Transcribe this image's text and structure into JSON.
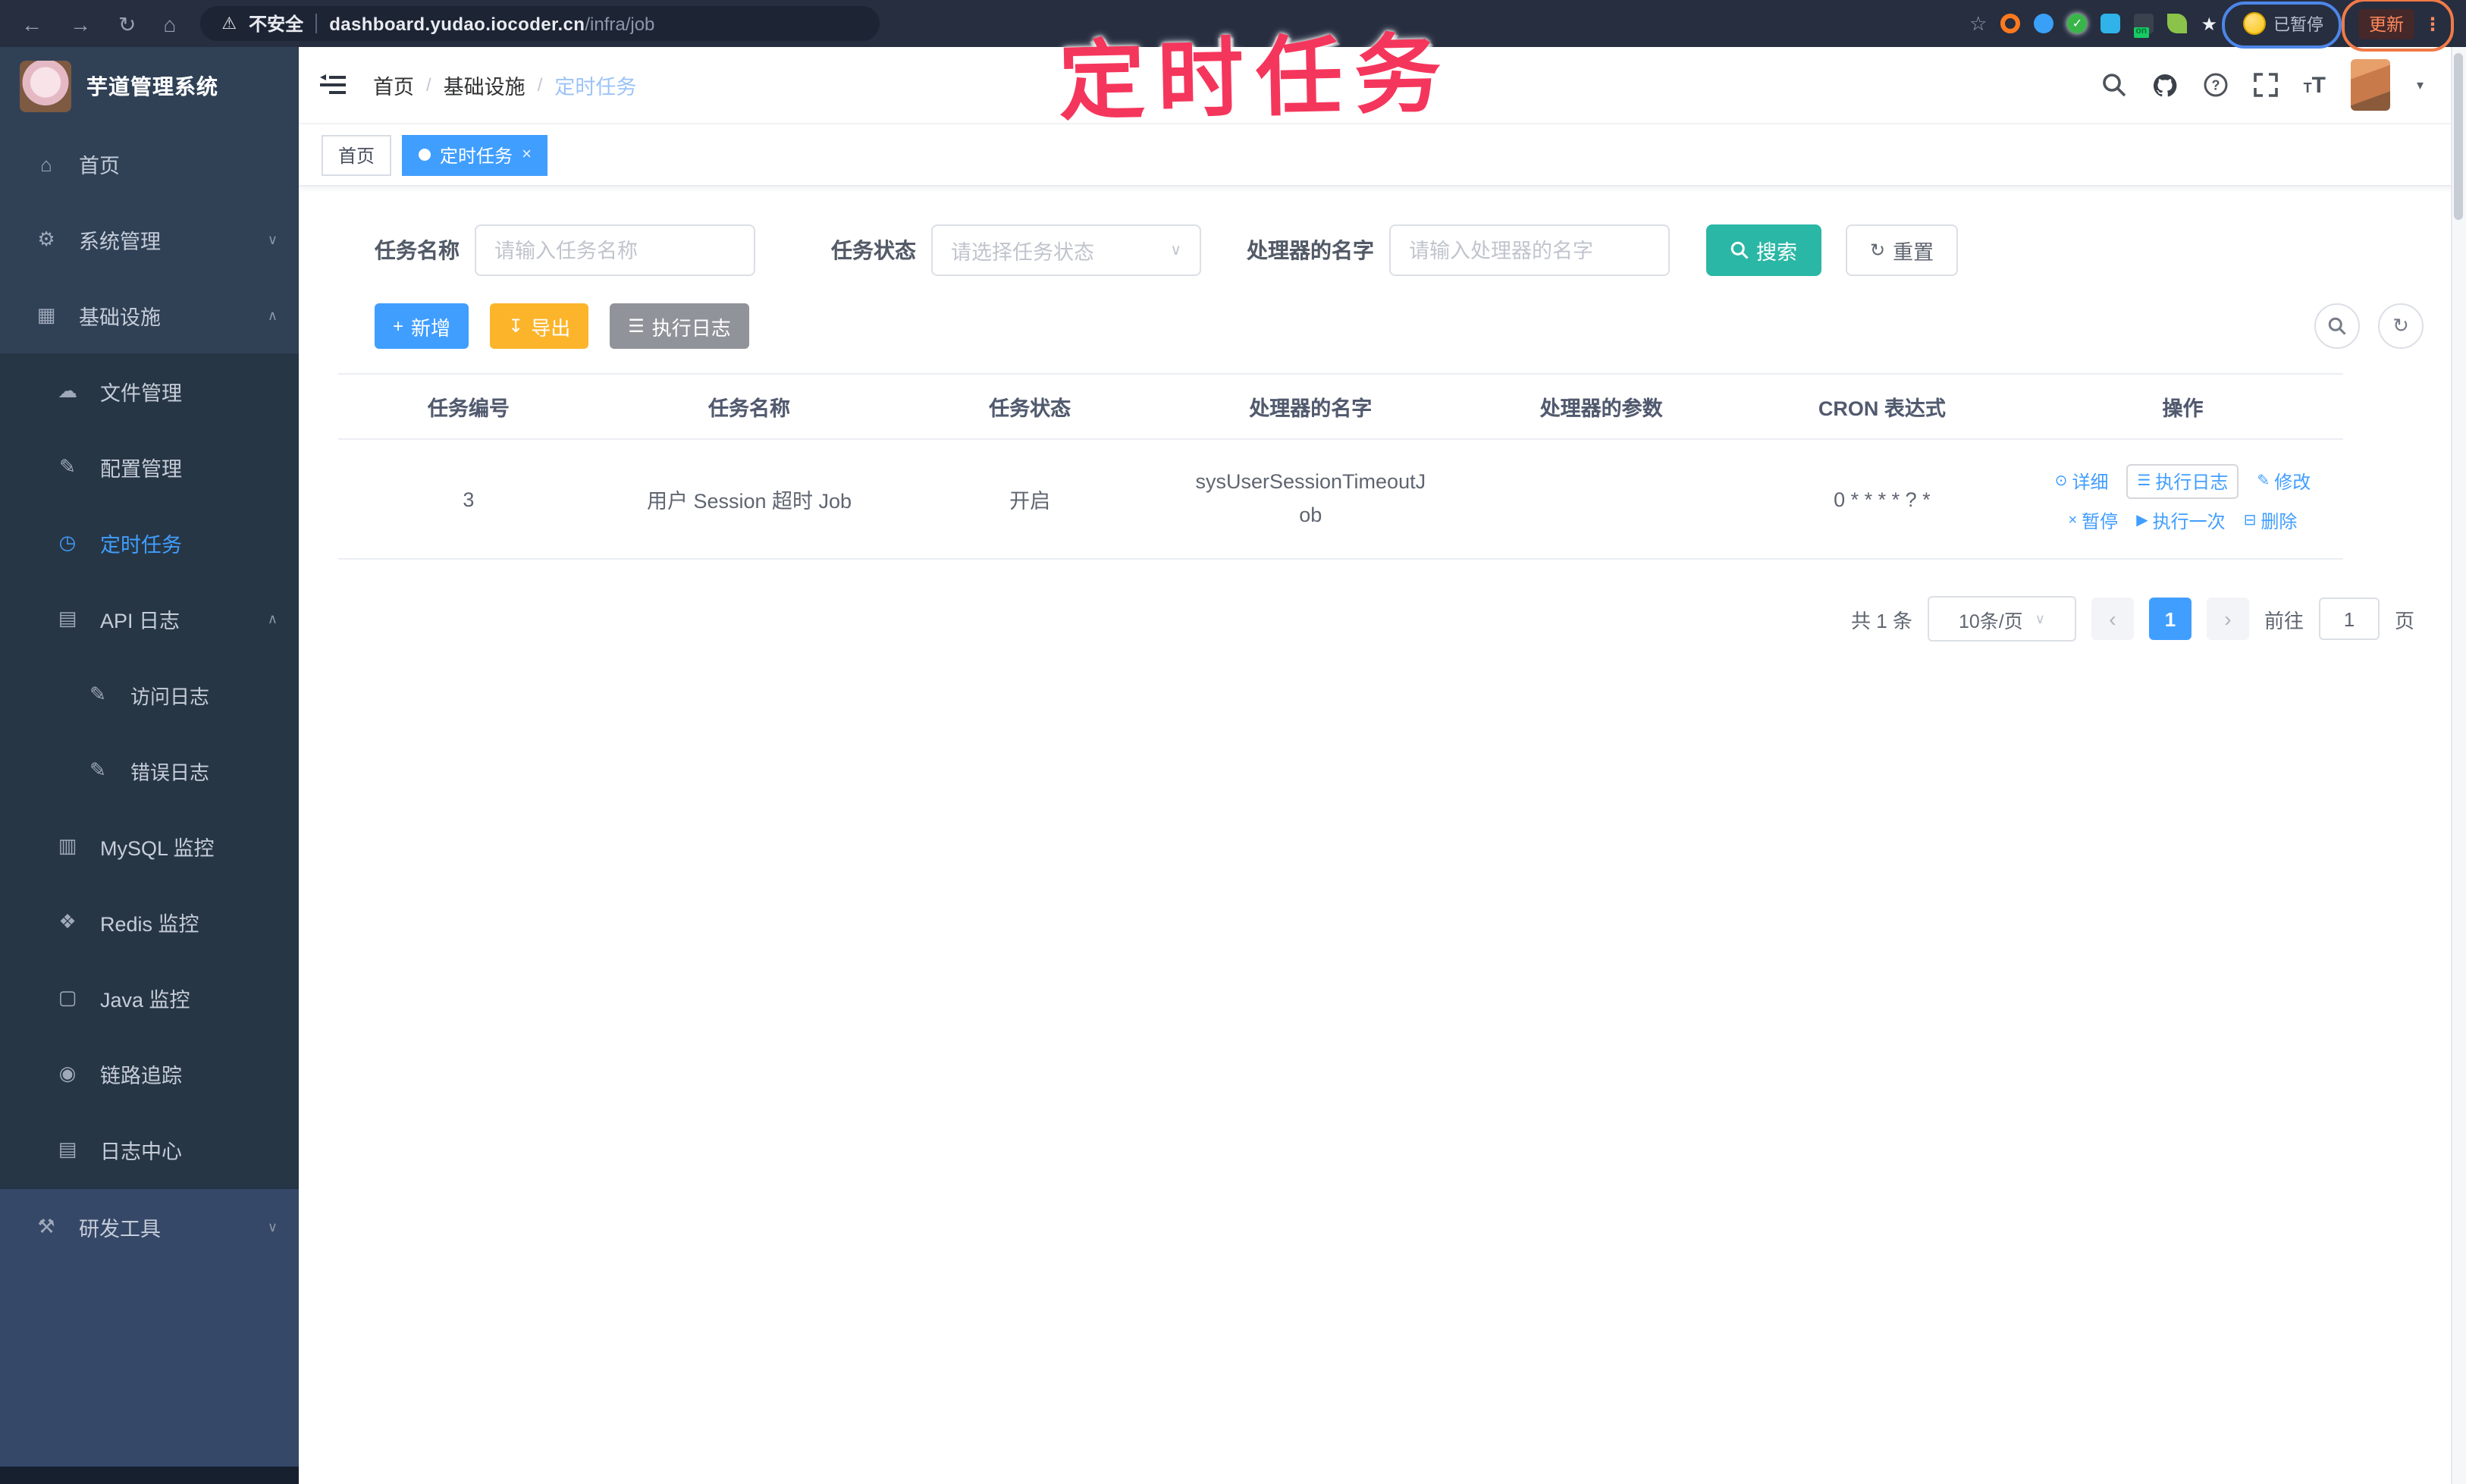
{
  "browser": {
    "security_label": "不安全",
    "url_domain": "dashboard.yudao.iocoder.cn",
    "url_path": "/infra/job",
    "paused_badge": "已暂停",
    "update_label": "更新",
    "extension_on_badge": "on"
  },
  "annotation": {
    "text": "定时任务",
    "color": "#f5365c"
  },
  "sidebar": {
    "title": "芋道管理系统",
    "items": [
      {
        "label": "首页"
      },
      {
        "label": "系统管理"
      },
      {
        "label": "基础设施"
      },
      {
        "label": "文件管理"
      },
      {
        "label": "配置管理"
      },
      {
        "label": "定时任务"
      },
      {
        "label": "API 日志"
      },
      {
        "label": "访问日志"
      },
      {
        "label": "错误日志"
      },
      {
        "label": "MySQL 监控"
      },
      {
        "label": "Redis 监控"
      },
      {
        "label": "Java 监控"
      },
      {
        "label": "链路追踪"
      },
      {
        "label": "日志中心"
      },
      {
        "label": "研发工具"
      }
    ]
  },
  "header": {
    "breadcrumb": [
      "首页",
      "基础设施",
      "定时任务"
    ]
  },
  "tabs": [
    {
      "label": "首页"
    },
    {
      "label": "定时任务"
    }
  ],
  "filters": {
    "name_label": "任务名称",
    "name_placeholder": "请输入任务名称",
    "status_label": "任务状态",
    "status_placeholder": "请选择任务状态",
    "handler_label": "处理器的名字",
    "handler_placeholder": "请输入处理器的名字",
    "search_label": "搜索",
    "reset_label": "重置"
  },
  "toolbar": {
    "add_label": "新增",
    "export_label": "导出",
    "exec_log_label": "执行日志"
  },
  "table": {
    "headers": [
      "任务编号",
      "任务名称",
      "任务状态",
      "处理器的名字",
      "处理器的参数",
      "CRON 表达式",
      "操作"
    ],
    "row": {
      "id": "3",
      "name": "用户 Session 超时 Job",
      "status": "开启",
      "handler": "sysUserSessionTimeoutJob",
      "param": "",
      "cron": "0 * * * * ? *",
      "ops": [
        "详细",
        "执行日志",
        "修改",
        "暂停",
        "执行一次",
        "删除"
      ]
    }
  },
  "pagination": {
    "total": "共 1 条",
    "page_size": "10条/页",
    "page": "1",
    "goto_label": "前往",
    "goto_value": "1",
    "page_unit": "页"
  },
  "colors": {
    "accent": "#409eff",
    "sidebar_bg": "#304156",
    "search_button": "#2bb7a5",
    "export_button": "#fcb42a",
    "info_button": "#909399",
    "annotation": "#f5365c",
    "active_tab": "#409eff"
  },
  "icons": {
    "back": "←",
    "forward": "→",
    "reload": "↻",
    "home": "⌂",
    "warning": "⚠",
    "star": "☆",
    "dots": "⋮",
    "caret_down": "▾",
    "chev_down": "∨",
    "chev_up": "∧",
    "ext_star": "★",
    "menu_home": "⌂",
    "menu_gear": "⚙",
    "menu_infra": "▦",
    "menu_cloud": "☁",
    "menu_edit": "✎",
    "menu_timer": "◷",
    "menu_apilog": "▤",
    "menu_accesslog": "✎",
    "menu_errorlog": "✎",
    "menu_mysql": "▥",
    "menu_redis": "❖",
    "menu_java": "▢",
    "menu_trace": "◉",
    "menu_logcenter": "▤",
    "menu_tools": "⚒",
    "btn_plus": "+",
    "btn_download": "↧",
    "btn_list": "☰",
    "btn_refresh": "↻",
    "btn_reset": "↻",
    "ops_detail": "⊙",
    "ops_log": "☰",
    "ops_edit": "✎",
    "ops_pause": "×",
    "ops_run": "▶",
    "ops_delete": "⊟",
    "pag_prev": "‹",
    "pag_next": "›",
    "tab_close": "×",
    "tsz_small": "T",
    "tsz_big": "T"
  }
}
